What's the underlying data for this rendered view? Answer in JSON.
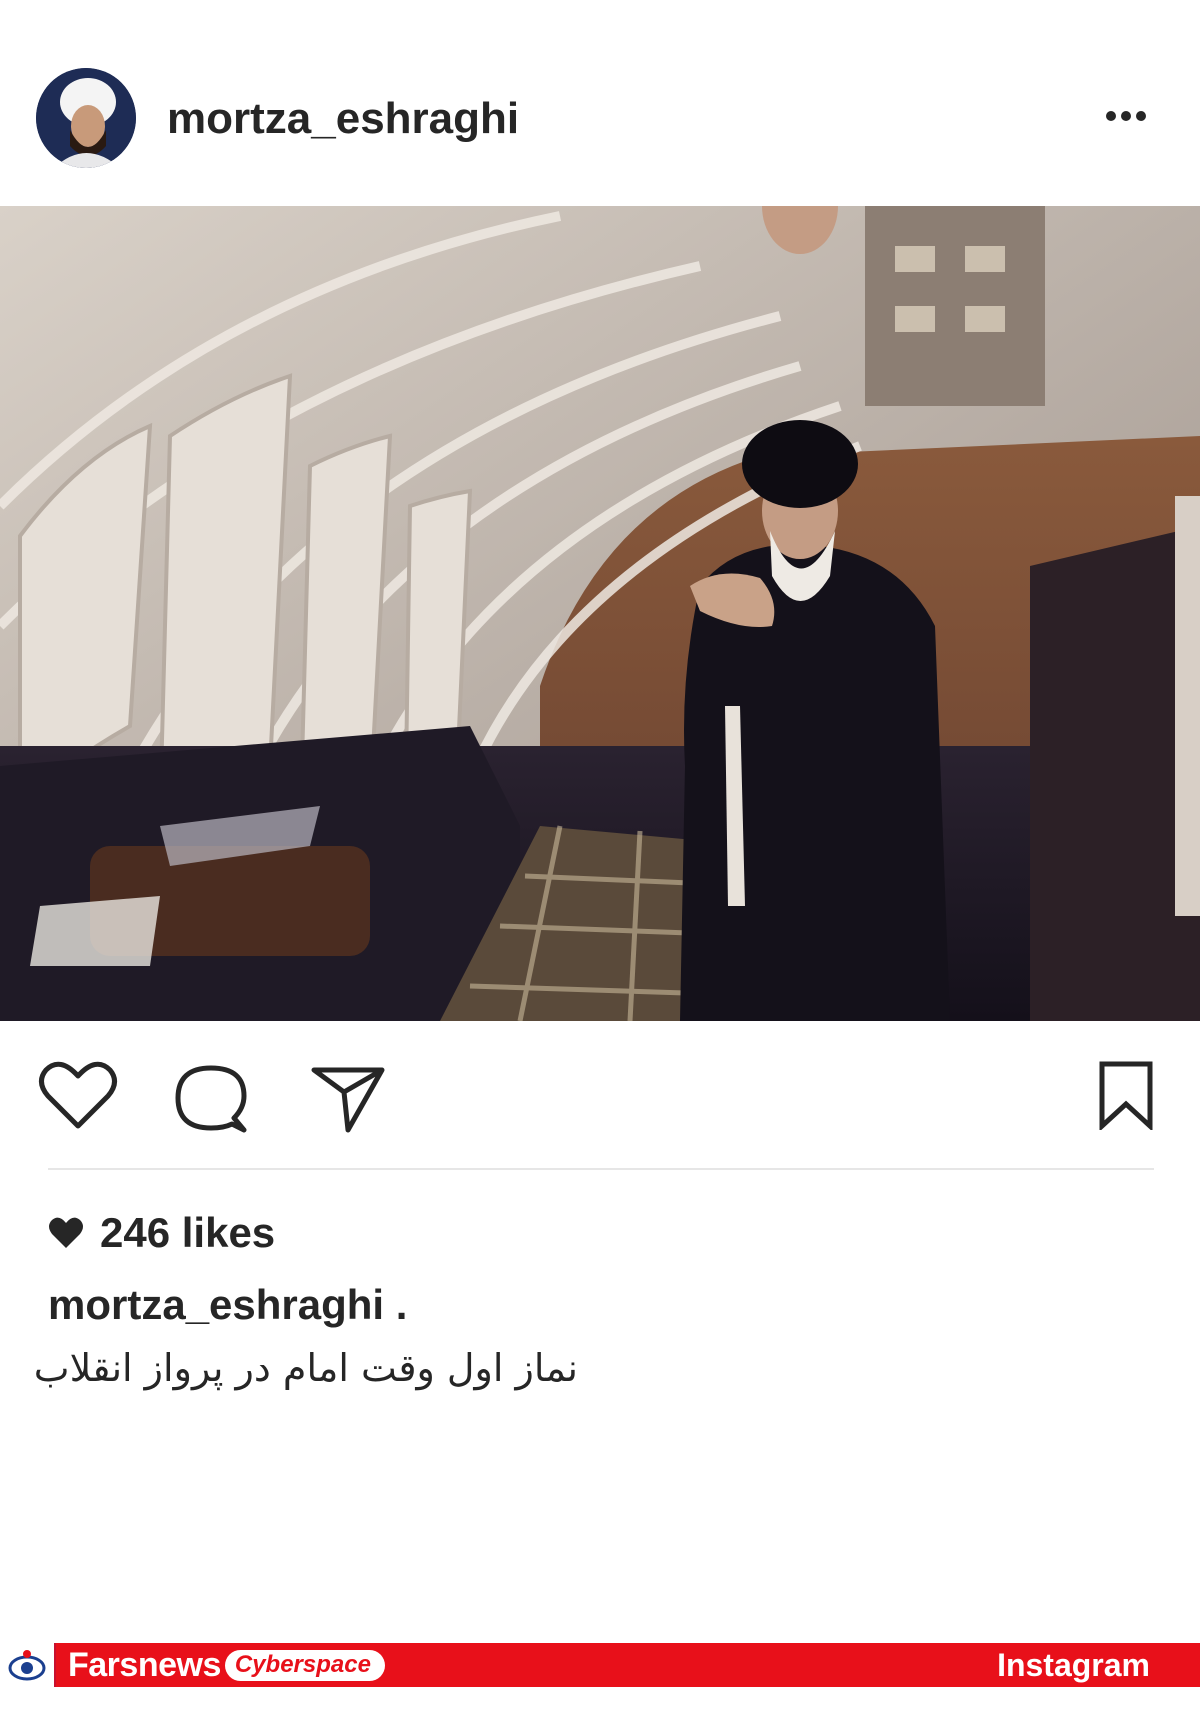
{
  "post": {
    "username": "mortza_eshraghi",
    "likes": "246 likes",
    "caption_user": "mortza_eshraghi .",
    "caption_text": "نماز اول وقت امام در پرواز انقلاب"
  },
  "icons": {
    "more": "more-options-icon",
    "like": "heart-icon",
    "comment": "comment-icon",
    "share": "paper-plane-icon",
    "save": "bookmark-icon"
  },
  "banner": {
    "brand": "Farsnews",
    "pill": "Cyberspace",
    "right": "Instagram"
  },
  "colors": {
    "banner_red": "#e8101a",
    "text": "#262626",
    "avatar_bg": "#1e2c55"
  }
}
